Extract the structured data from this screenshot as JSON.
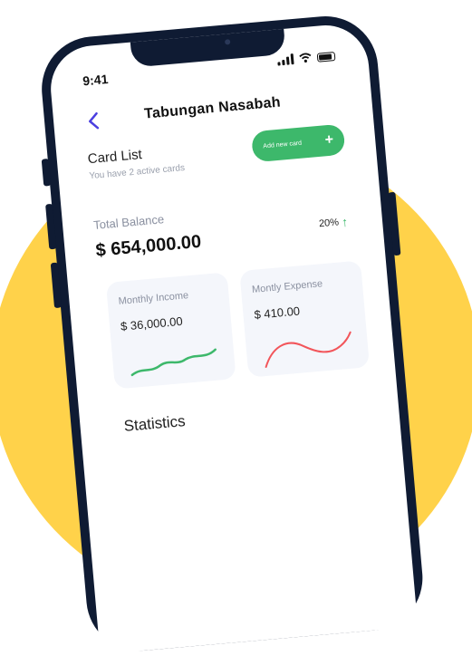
{
  "status": {
    "time": "9:41"
  },
  "header": {
    "title": "Tabungan Nasabah"
  },
  "card_list": {
    "title": "Card List",
    "subtitle": "You have 2 active cards",
    "add_button_label": "Add new card",
    "add_button_symbol": "+"
  },
  "balance": {
    "label": "Total Balance",
    "value": "$ 654,000.00",
    "change_percent": "20%"
  },
  "income": {
    "label": "Monthly Income",
    "value": "$ 36,000.00"
  },
  "expense": {
    "label": "Montly Expense",
    "value": "$ 410.00"
  },
  "statistics": {
    "title": "Statistics"
  },
  "colors": {
    "accent_green": "#3DB86B",
    "expense_red": "#F2555A",
    "back_chevron": "#4B3FE0",
    "background_circle": "#FFD24A",
    "phone_frame": "#0F1B33"
  },
  "icons": [
    "back-chevron-icon",
    "plus-icon",
    "arrow-up-icon",
    "signal-icon",
    "wifi-icon",
    "battery-icon"
  ]
}
